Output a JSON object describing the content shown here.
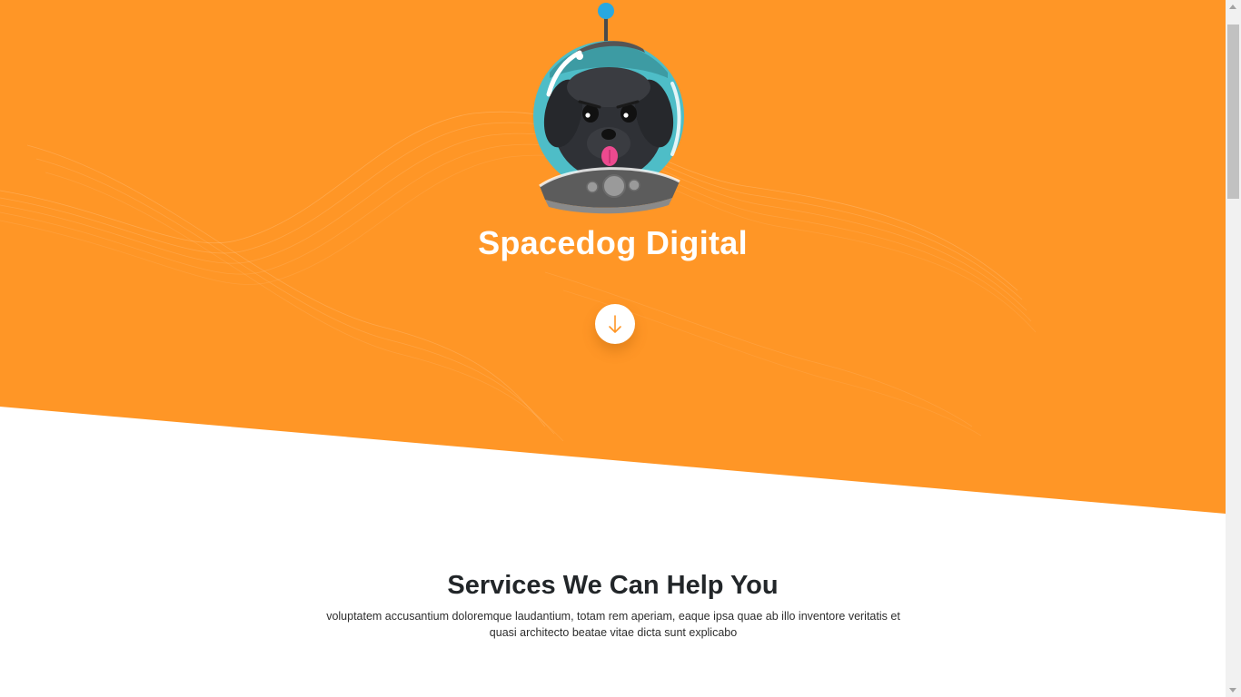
{
  "hero": {
    "title": "Spacedog Digital",
    "scroll_button_label": "↓",
    "logo_icon": "spacedog-astronaut-dog-logo",
    "background_color": "#ff9626"
  },
  "services": {
    "title": "Services We Can Help You",
    "description": "voluptatem accusantium doloremque laudantium, totam rem aperiam, eaque ipsa quae ab illo inventore veritatis et quasi architecto beatae vitae dicta sunt explicabo"
  },
  "colors": {
    "accent": "#ff9626",
    "helmet": "#4ebdc7",
    "antenna_tip": "#29a8e0",
    "tongue": "#ec4a8f"
  }
}
